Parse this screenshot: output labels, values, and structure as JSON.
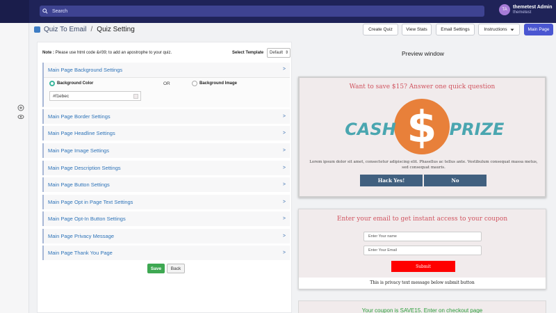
{
  "topbar": {
    "search_placeholder": "Search",
    "user_name": "themetest Admin",
    "user_sub": "themetest",
    "avatar_initials": "TA"
  },
  "header": {
    "breadcrumb_app": "Quiz To Email",
    "breadcrumb_sep": "/",
    "breadcrumb_current": "Quiz Setting",
    "buttons": [
      "Create Quiz",
      "View Stats",
      "Email Settings",
      "Instructions",
      "Main Page"
    ]
  },
  "settings": {
    "note_label": "Note :",
    "note_text": "Please use html code &#39; to add an apostrophe to your quiz.",
    "template_label": "Select Template",
    "template_value": "Default",
    "open_section": "Main Page Background Settings",
    "bg_color_label": "Background Color",
    "or_text": "OR",
    "bg_image_label": "Background Image",
    "bg_color_value": "#f1ebec",
    "sections": [
      "Main Page Border Settings",
      "Main Page Headline Settings",
      "Main Page Image Settings",
      "Main Page Description Settings",
      "Main Page Button Settings",
      "Main Page Opt in Page Text Settings",
      "Main Page Opt-In Button Settings",
      "Main Page Privacy Message",
      "Main Page Thank You Page"
    ],
    "chevron": ">",
    "save_label": "Save",
    "back_label": "Back"
  },
  "preview": {
    "title": "Preview window",
    "card1_headline": "Want to save $15? Answer one quick question",
    "logo_left": "CASH",
    "logo_symbol": "$",
    "logo_right": "PRIZE",
    "card1_desc": "Lorem ipsum dolor sit amet, consectetur adipiscing elit. Phasellus ac tellus ante. Vestibulum consequat massa metus, sed consequat mauris.",
    "yes_label": "Hack Yes!",
    "no_label": "No",
    "card2_headline": "Enter your email to get instant access to your coupon",
    "name_placeholder": "Enter Your name",
    "email_placeholder": "Enter Your Email",
    "submit_label": "Submit",
    "privacy_text": "This is privacy text message below submit button",
    "card3_headline": "Your coupon is SAVE15. Enter on checkout page"
  },
  "colors": {
    "topbar": "#1f2358",
    "accent": "#4a56d1",
    "headline": "#d0535f",
    "cash_text": "#4aa6b0",
    "coin": "#e8803a",
    "button": "#41607f",
    "submit": "#ff0000",
    "coupon": "#2a9d3a"
  }
}
